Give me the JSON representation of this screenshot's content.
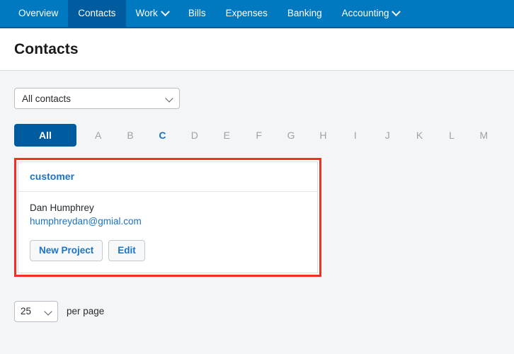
{
  "nav": {
    "items": [
      {
        "label": "Overview",
        "active": false,
        "has_caret": false
      },
      {
        "label": "Contacts",
        "active": true,
        "has_caret": false
      },
      {
        "label": "Work",
        "active": false,
        "has_caret": true
      },
      {
        "label": "Bills",
        "active": false,
        "has_caret": false
      },
      {
        "label": "Expenses",
        "active": false,
        "has_caret": false
      },
      {
        "label": "Banking",
        "active": false,
        "has_caret": false
      },
      {
        "label": "Accounting",
        "active": false,
        "has_caret": true
      }
    ]
  },
  "header": {
    "title": "Contacts"
  },
  "filter": {
    "select_value": "All contacts",
    "chevron_icon": "chevron-down-icon"
  },
  "alphabet": {
    "all_label": "All",
    "letters": [
      {
        "label": "A",
        "enabled": false
      },
      {
        "label": "B",
        "enabled": false
      },
      {
        "label": "C",
        "enabled": true
      },
      {
        "label": "D",
        "enabled": false
      },
      {
        "label": "E",
        "enabled": false
      },
      {
        "label": "F",
        "enabled": false
      },
      {
        "label": "G",
        "enabled": false
      },
      {
        "label": "H",
        "enabled": false
      },
      {
        "label": "I",
        "enabled": false
      },
      {
        "label": "J",
        "enabled": false
      },
      {
        "label": "K",
        "enabled": false
      },
      {
        "label": "L",
        "enabled": false
      },
      {
        "label": "M",
        "enabled": false
      }
    ]
  },
  "card": {
    "group_title": "customer",
    "contact_name": "Dan Humphrey",
    "contact_email": "humphreydan@gmial.com",
    "new_project_label": "New Project",
    "edit_label": "Edit",
    "highlight_color": "#ee3124"
  },
  "footer": {
    "per_page_value": "25",
    "per_page_label": "per page",
    "chevron_icon": "chevron-down-icon"
  },
  "colors": {
    "nav_bg": "#0079c1",
    "nav_active_bg": "#005c9e",
    "link_blue": "#1a73c4",
    "page_bg": "#f4f5f7"
  }
}
